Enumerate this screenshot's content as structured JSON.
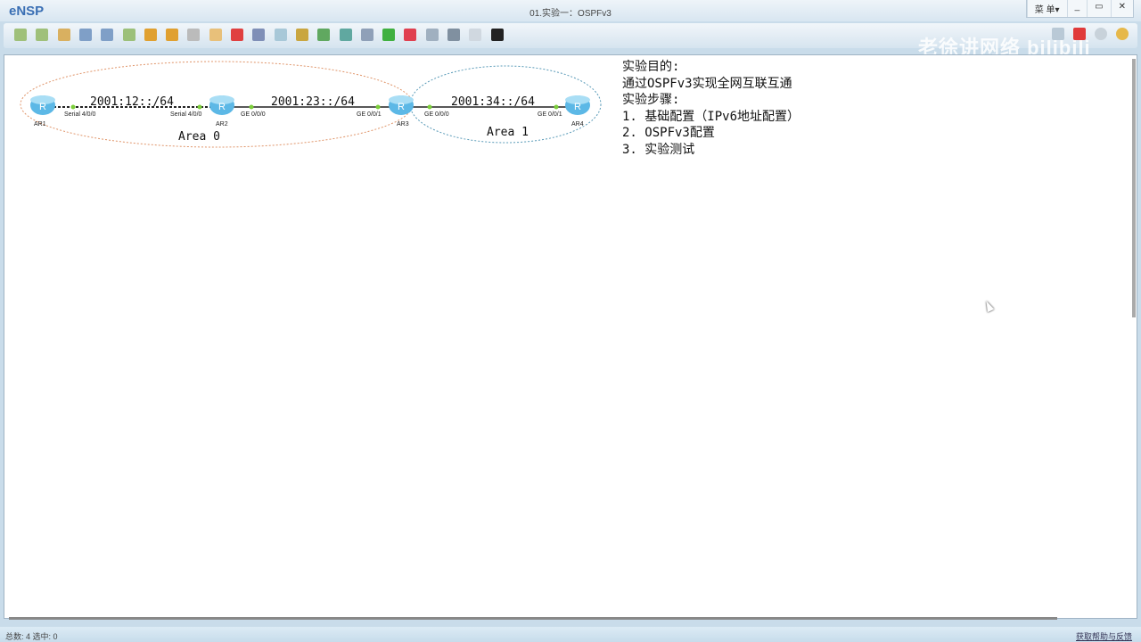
{
  "app": {
    "logo": "eNSP",
    "title": "01.实验一：OSPFv3",
    "menu": "菜 单▾",
    "minimize": "_",
    "restore": "▭",
    "close": "✕",
    "watermark": "老徐讲网络 bilibili"
  },
  "topology": {
    "routers": [
      {
        "name": "AR1"
      },
      {
        "name": "AR2"
      },
      {
        "name": "AR3"
      },
      {
        "name": "AR4"
      }
    ],
    "links": [
      {
        "network": "2001:12::/64",
        "a_port": "Serial 4/0/0",
        "b_port": "Serial 4/0/0"
      },
      {
        "network": "2001:23::/64",
        "a_port": "GE 0/0/0",
        "b_port": "GE 0/0/1"
      },
      {
        "network": "2001:34::/64",
        "a_port": "GE 0/0/0",
        "b_port": "GE 0/0/1"
      }
    ],
    "areas": [
      {
        "label": "Area 0",
        "color": "#e0956a"
      },
      {
        "label": "Area 1",
        "color": "#5a9bb8"
      }
    ]
  },
  "notes": [
    "实验目的:",
    "通过OSPFv3实现全网互联互通",
    "实验步骤:",
    "1. 基础配置（IPv6地址配置）",
    "2. OSPFv3配置",
    "3. 实验测试"
  ],
  "status": {
    "left": "总数: 4 选中: 0",
    "right": "获取帮助与反馈"
  }
}
